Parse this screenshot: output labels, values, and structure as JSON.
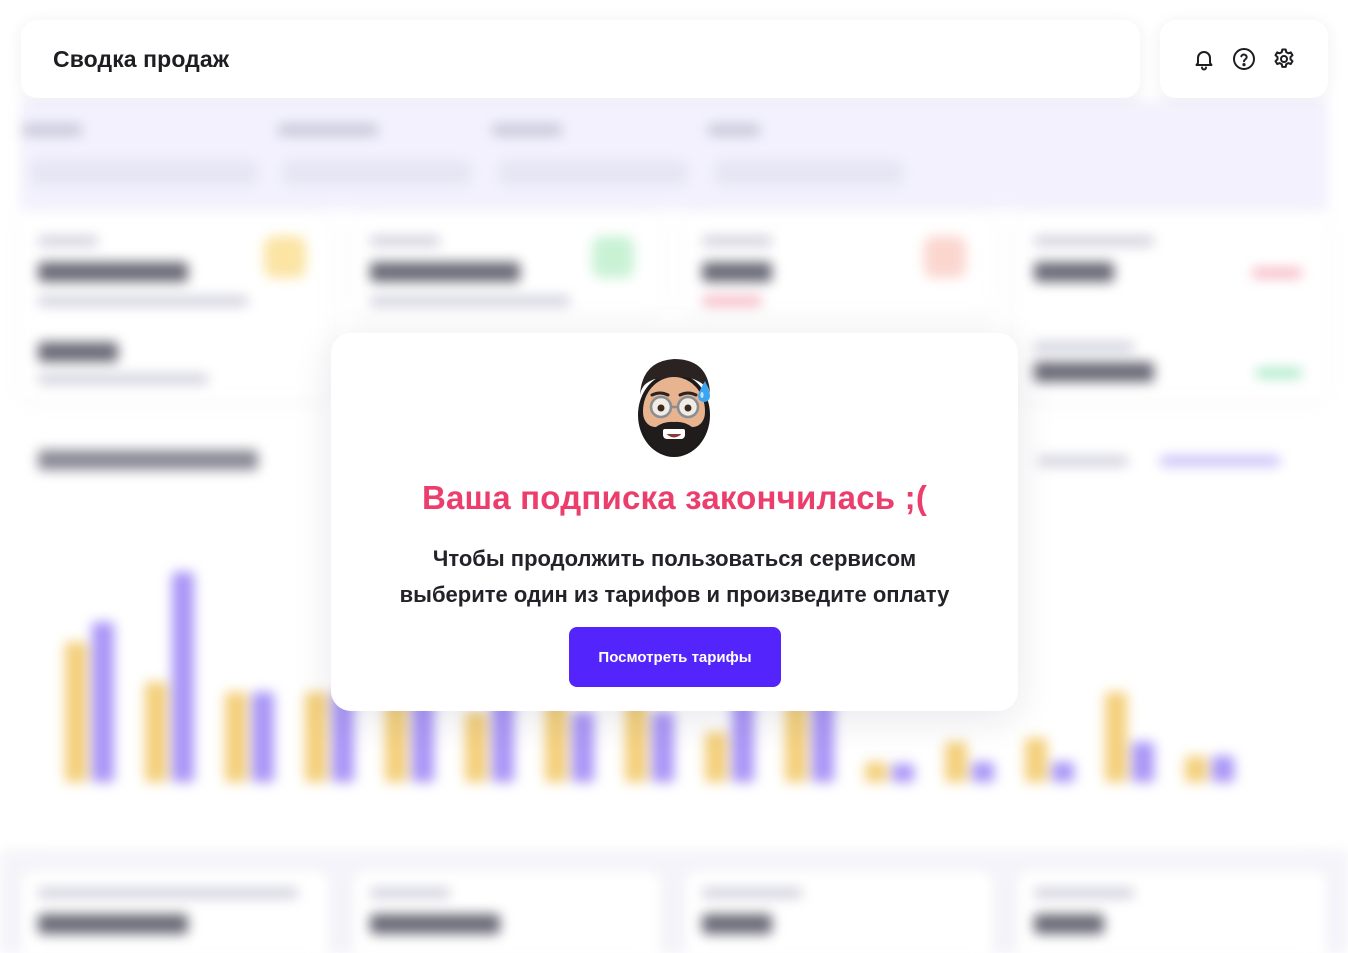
{
  "header": {
    "title": "Сводка продаж",
    "icons": [
      "bell-icon",
      "help-icon",
      "gear-icon"
    ]
  },
  "modal": {
    "title": "Ваша подписка закончилась ;(",
    "text_line1": "Чтобы продолжить пользоваться сервисом",
    "text_line2": "выберите один из тарифов и произведите оплату",
    "button_label": "Посмотреть тарифы",
    "avatar_icon": "memoji-sweat-avatar"
  },
  "colors": {
    "accent": "#5324fb",
    "title_red": "#ec3e6c",
    "bar_yellow": "#f3cf7a",
    "bar_purple": "#a895f7"
  }
}
